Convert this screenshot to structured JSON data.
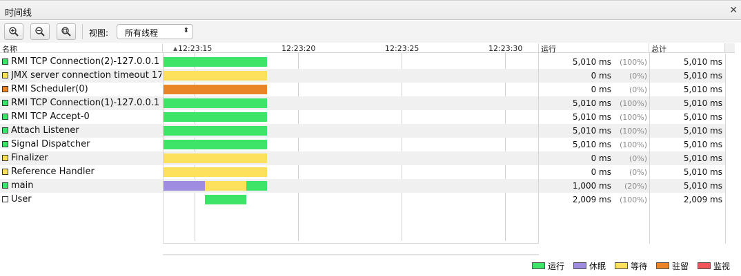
{
  "window": {
    "title": "时间线"
  },
  "toolbar": {
    "zoom_in": "zoom-in-icon",
    "zoom_out": "zoom-out-icon",
    "zoom_fit": "zoom-fit-icon",
    "view_label": "视图:",
    "view_value": "所有线程"
  },
  "colors": {
    "running": "#3de467",
    "sleeping": "#9e8ce0",
    "waiting": "#fde15c",
    "parked": "#ea8527",
    "monitor": "#f0555a"
  },
  "table": {
    "columns": {
      "name": "名称",
      "running": "运行",
      "total": "总计"
    },
    "ticks": [
      "12:23:15",
      "12:23:20",
      "12:23:25",
      "12:23:30"
    ],
    "rows": [
      {
        "name": "RMI TCP Connection(2)-127.0.0.1",
        "state": "running",
        "timeline": [
          {
            "state": "running",
            "from": 0,
            "to": 5.01
          }
        ],
        "running": "5,010 ms",
        "pct": "(100%)",
        "total": "5,010 ms"
      },
      {
        "name": "JMX server connection timeout 17",
        "state": "waiting",
        "timeline": [
          {
            "state": "waiting",
            "from": 0,
            "to": 5.01
          }
        ],
        "running": "0 ms",
        "pct": "(0%)",
        "total": "5,010 ms"
      },
      {
        "name": "RMI Scheduler(0)",
        "state": "parked",
        "timeline": [
          {
            "state": "parked",
            "from": 0,
            "to": 5.01
          }
        ],
        "running": "0 ms",
        "pct": "(0%)",
        "total": "5,010 ms"
      },
      {
        "name": "RMI TCP Connection(1)-127.0.0.1",
        "state": "running",
        "timeline": [
          {
            "state": "running",
            "from": 0,
            "to": 5.01
          }
        ],
        "running": "5,010 ms",
        "pct": "(100%)",
        "total": "5,010 ms"
      },
      {
        "name": "RMI TCP Accept-0",
        "state": "running",
        "timeline": [
          {
            "state": "running",
            "from": 0,
            "to": 5.01
          }
        ],
        "running": "5,010 ms",
        "pct": "(100%)",
        "total": "5,010 ms"
      },
      {
        "name": "Attach Listener",
        "state": "running",
        "timeline": [
          {
            "state": "running",
            "from": 0,
            "to": 5.01
          }
        ],
        "running": "5,010 ms",
        "pct": "(100%)",
        "total": "5,010 ms"
      },
      {
        "name": "Signal Dispatcher",
        "state": "running",
        "timeline": [
          {
            "state": "running",
            "from": 0,
            "to": 5.01
          }
        ],
        "running": "5,010 ms",
        "pct": "(100%)",
        "total": "5,010 ms"
      },
      {
        "name": "Finalizer",
        "state": "waiting",
        "timeline": [
          {
            "state": "waiting",
            "from": 0,
            "to": 5.01
          }
        ],
        "running": "0 ms",
        "pct": "(0%)",
        "total": "5,010 ms"
      },
      {
        "name": "Reference Handler",
        "state": "waiting",
        "timeline": [
          {
            "state": "waiting",
            "from": 0,
            "to": 5.01
          }
        ],
        "running": "0 ms",
        "pct": "(0%)",
        "total": "5,010 ms"
      },
      {
        "name": "main",
        "state": "running",
        "timeline": [
          {
            "state": "sleeping",
            "from": 0,
            "to": 2
          },
          {
            "state": "waiting",
            "from": 2,
            "to": 4
          },
          {
            "state": "running",
            "from": 4,
            "to": 5.01
          }
        ],
        "running": "1,000 ms",
        "pct": "(20%)",
        "total": "5,010 ms"
      },
      {
        "name": "User",
        "state": "none",
        "timeline": [
          {
            "state": "running",
            "from": 2,
            "to": 4
          }
        ],
        "running": "2,009 ms",
        "pct": "(100%)",
        "total": "2,009 ms"
      }
    ]
  },
  "legend": [
    {
      "state": "running",
      "label": "运行"
    },
    {
      "state": "sleeping",
      "label": "休眠"
    },
    {
      "state": "waiting",
      "label": "等待"
    },
    {
      "state": "parked",
      "label": "驻留"
    },
    {
      "state": "monitor",
      "label": "监视"
    }
  ]
}
